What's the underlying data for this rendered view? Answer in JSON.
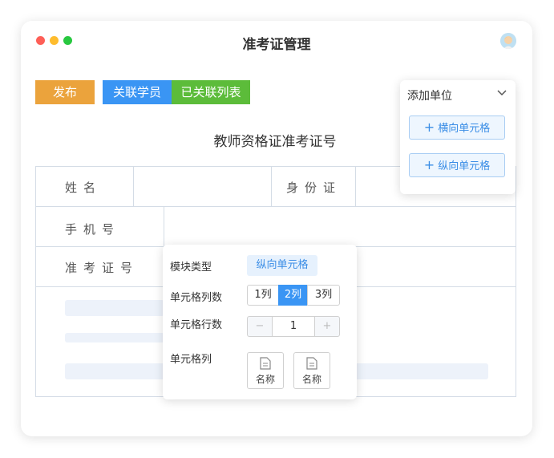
{
  "window": {
    "title": "准考证管理"
  },
  "colors": {
    "red": "#fe5f57",
    "yellow": "#febc2e",
    "green": "#28c840",
    "publish": "#eba33c",
    "link": "#3a95f4",
    "linked": "#5cbc3a",
    "accent": "#3a8de6"
  },
  "toolbar": {
    "publish": "发布",
    "link_students": "关联学员",
    "linked_list": "已关联列表"
  },
  "form": {
    "heading": "教师资格证准考证号",
    "name_label": "姓名",
    "id_label": "身份证",
    "phone_label": "手机号",
    "ticket_label": "准考证号"
  },
  "add_unit": {
    "title": "添加单位",
    "horizontal": "横向单元格",
    "vertical": "纵向单元格"
  },
  "cell_panel": {
    "module_type_label": "模块类型",
    "module_type_value": "纵向单元格",
    "columns_label": "单元格列数",
    "column_options": [
      "1列",
      "2列",
      "3列"
    ],
    "selected_columns": "2列",
    "rows_label": "单元格行数",
    "rows_value": "1",
    "cols_label": "单元格列",
    "col_items": [
      "名称",
      "名称"
    ]
  }
}
